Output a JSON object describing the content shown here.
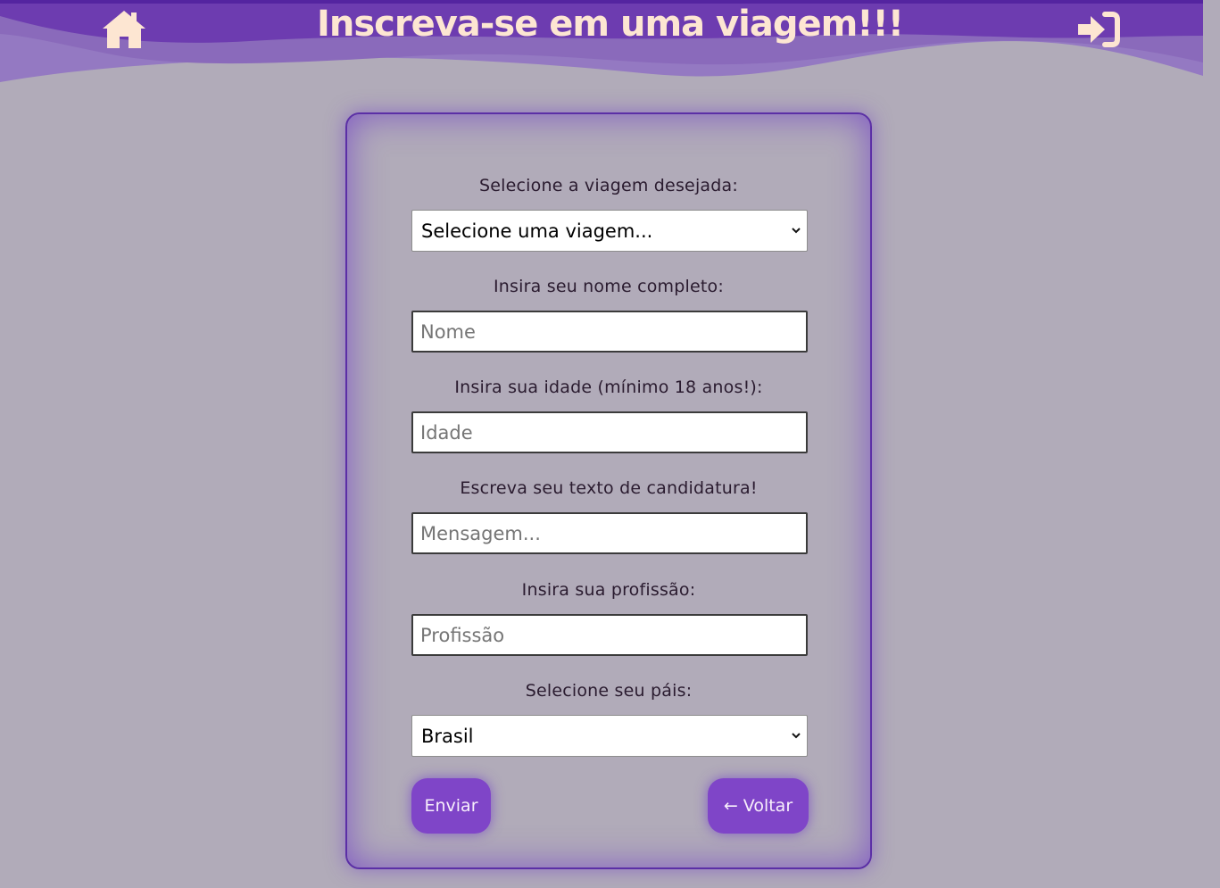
{
  "header": {
    "title": "Inscreva-se em uma viagem!!!",
    "home_icon": "home-icon",
    "login_icon": "sign-in-icon"
  },
  "form": {
    "trip_label": "Selecione a viagem desejada:",
    "trip_select_value": "Selecione uma viagem...",
    "name_label": "Insira seu nome completo:",
    "name_placeholder": "Nome",
    "age_label": "Insira sua idade (mínimo 18 anos!):",
    "age_placeholder": "Idade",
    "text_label": "Escreva seu texto de candidatura!",
    "text_placeholder": "Mensagem...",
    "profession_label": "Insira sua profissão:",
    "profession_placeholder": "Profissão",
    "country_label": "Selecione seu páis:",
    "country_select_value": "Brasil",
    "submit_label": "Enviar",
    "back_label": "← Voltar"
  },
  "colors": {
    "background": "#b1abb9",
    "header_dark": "#6330a8",
    "header_light": "#9479c2",
    "accent": "#7f45c8",
    "title": "#fde6d2"
  }
}
